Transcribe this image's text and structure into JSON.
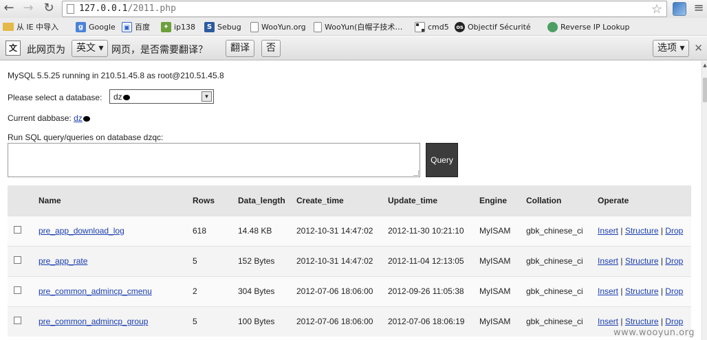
{
  "browser": {
    "url_host": "127.0.0.1",
    "url_path": "/2011.php",
    "back_icon": "arrow-left-icon",
    "forward_icon": "arrow-right-icon",
    "reload_icon": "reload-icon",
    "star_icon": "star-icon",
    "menu_icon": "wrench-menu-icon"
  },
  "bookmarks": [
    {
      "label": "从 IE 中导入",
      "icon": "folder-icon"
    },
    {
      "label": "Google",
      "icon": "google-icon"
    },
    {
      "label": "百度",
      "icon": "baidu-icon"
    },
    {
      "label": "ip138",
      "icon": "ip138-icon"
    },
    {
      "label": "Sebug",
      "icon": "sebug-icon"
    },
    {
      "label": "WooYun.org",
      "icon": "page-icon"
    },
    {
      "label": "WooYun(白帽子技术…",
      "icon": "page-icon"
    },
    {
      "label": "cmd5",
      "icon": "cmd5-icon"
    },
    {
      "label": "Objectif Sécurité",
      "icon": "objectif-icon"
    },
    {
      "label": "Reverse IP Lookup",
      "icon": "globe-icon"
    }
  ],
  "translate_bar": {
    "prefix": "此网页为",
    "language": "英文",
    "question": "网页，是否需要翻译？",
    "translate_button": "翻译",
    "no_button": "否",
    "options_button": "选项"
  },
  "page": {
    "server_info": "MySQL 5.5.25 running in 210.51.45.8 as root@210.51.45.8",
    "select_label": "Please select a database:",
    "select_value": "dz",
    "current_label": "Current dabbase:",
    "current_value": "dz",
    "run_label": "Run SQL query/queries on database dzqc:",
    "query_button": "Query"
  },
  "table": {
    "headers": [
      "",
      "Name",
      "Rows",
      "Data_length",
      "Create_time",
      "Update_time",
      "Engine",
      "Collation",
      "Operate"
    ],
    "rows": [
      {
        "name": "pre_app_download_log",
        "rows": "618",
        "data_length": "14.48 KB",
        "create_time": "2012-10-31 14:47:02",
        "update_time": "2012-11-30 10:21:10",
        "engine": "MyISAM",
        "collation": "gbk_chinese_ci"
      },
      {
        "name": "pre_app_rate",
        "rows": "5",
        "data_length": "152 Bytes",
        "create_time": "2012-10-31 14:47:02",
        "update_time": "2012-11-04 12:13:05",
        "engine": "MyISAM",
        "collation": "gbk_chinese_ci"
      },
      {
        "name": "pre_common_admincp_cmenu",
        "rows": "2",
        "data_length": "304 Bytes",
        "create_time": "2012-07-06 18:06:00",
        "update_time": "2012-09-26 11:05:38",
        "engine": "MyISAM",
        "collation": "gbk_chinese_ci"
      },
      {
        "name": "pre_common_admincp_group",
        "rows": "5",
        "data_length": "100 Bytes",
        "create_time": "2012-07-06 18:06:00",
        "update_time": "2012-07-06 18:06:19",
        "engine": "MyISAM",
        "collation": "gbk_chinese_ci"
      }
    ],
    "operate": {
      "insert": "Insert",
      "separator": " | ",
      "structure": "Structure",
      "drop": "Drop"
    }
  },
  "watermark": "www.wooyun.org"
}
